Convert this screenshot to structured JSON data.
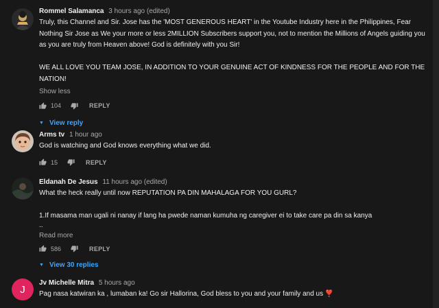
{
  "comments": [
    {
      "author": "Rommel Salamanca",
      "time": "3 hours ago (edited)",
      "text": "Truly, this Channel and Sir. Jose has the 'MOST GENEROUS HEART' in the Youtube Industry here in the Philippines, Fear Nothing Sir Jose as We your more or less 2MILLION Subscribers support you, not to mention the Millions of Angels guiding you as you are truly from Heaven above! God is definitely with you Sir!\n\nWE ALL LOVE YOU TEAM JOSE, IN ADDITION TO YOUR GENUINE ACT OF KINDNESS FOR THE PEOPLE AND FOR THE NATION!",
      "more_label": "Show less",
      "likes": "104",
      "reply_label": "REPLY",
      "replies_label": "View reply"
    },
    {
      "author": "Arms tv",
      "time": "1 hour ago",
      "text": "God is watching and God knows everything what we did.",
      "likes": "15",
      "reply_label": "REPLY"
    },
    {
      "author": "Eldanah De Jesus",
      "time": "11 hours ago (edited)",
      "text": "What the heck really until now REPUTATION PA DIN MAHALAGA FOR YOU GURL?\n\n1.If masama man ugali ni nanay if lang ha pwede naman kumuha ng caregiver ei to take care pa din sa kanya",
      "ellipsis": "..",
      "more_label": "Read more",
      "likes": "586",
      "reply_label": "REPLY",
      "replies_label": "View 30 replies"
    },
    {
      "author": "Jv Michelle Mitra",
      "time": "5 hours ago",
      "avatar_letter": "J",
      "text": "Pag nasa katwiran ka , lumaban ka! Go sir Hallorina, God bless to you and your family and us ❣️"
    }
  ],
  "colors": {
    "background": "#181818",
    "link": "#3ea6ff",
    "avatar_j": "#e0245e"
  },
  "icons": [
    "thumb-up-icon",
    "thumb-down-icon",
    "caret-down-icon"
  ]
}
